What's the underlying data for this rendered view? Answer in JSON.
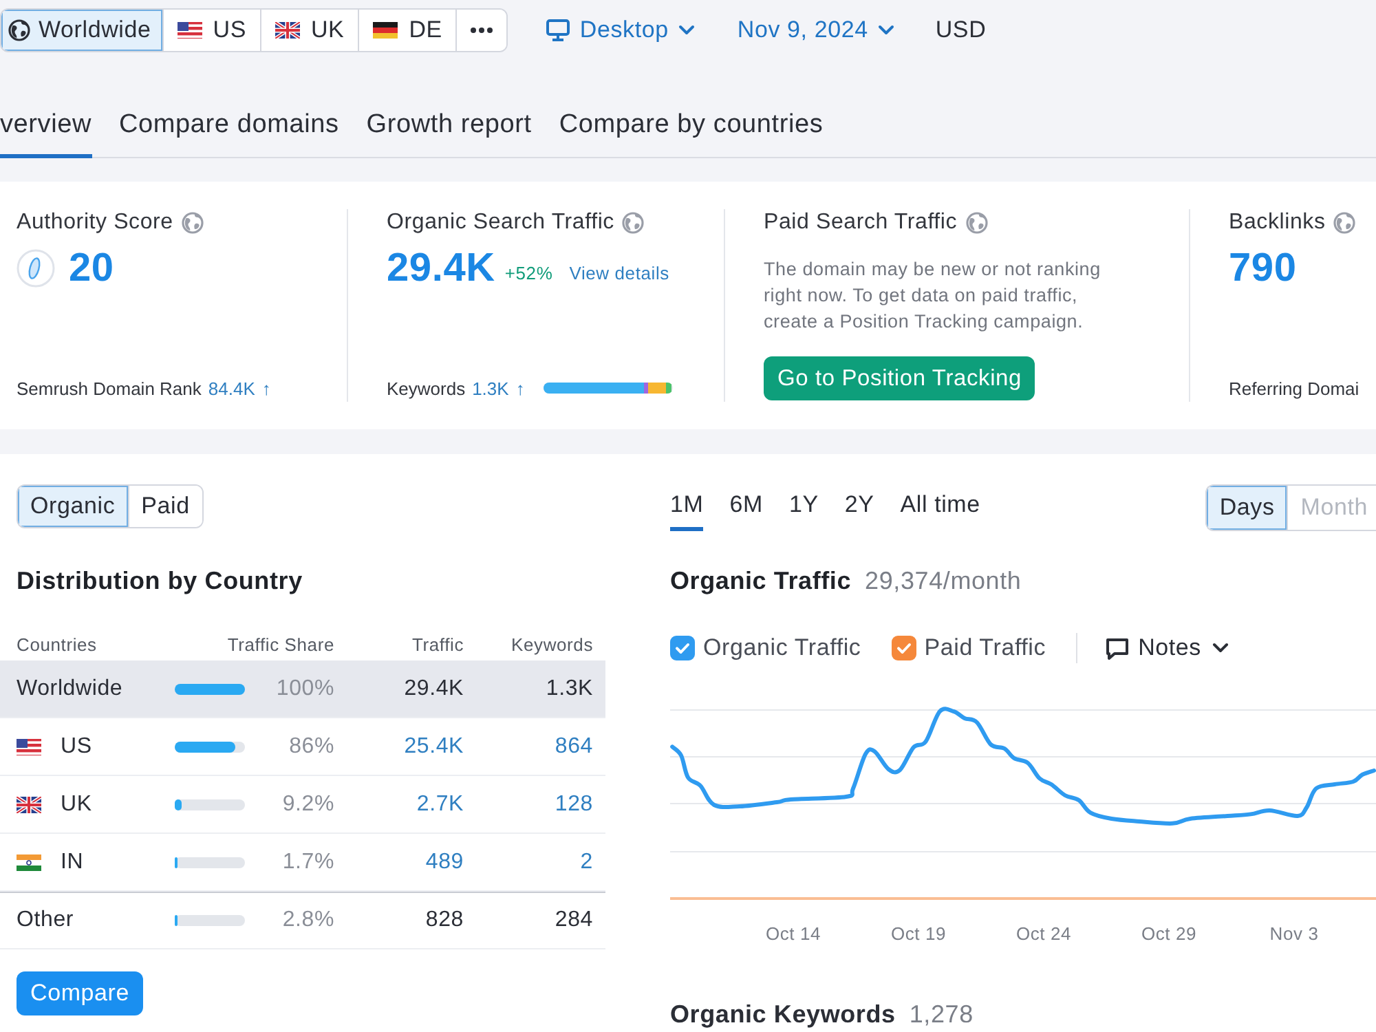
{
  "location_bar": {
    "regions": [
      {
        "kind": "globe",
        "label": "Worldwide",
        "selected": true
      },
      {
        "kind": "usa",
        "label": "US",
        "selected": false
      },
      {
        "kind": "britain",
        "label": "UK",
        "selected": false
      },
      {
        "kind": "germany",
        "label": "DE",
        "selected": false
      },
      {
        "kind": "more",
        "selected": false
      }
    ],
    "device": "Desktop",
    "date": "Nov 9, 2024",
    "currency": "USD"
  },
  "tabs": [
    {
      "label": "verview",
      "selected": true
    },
    {
      "label": "Compare domains",
      "selected": false
    },
    {
      "label": "Growth report",
      "selected": false
    },
    {
      "label": "Compare by countries",
      "selected": false
    }
  ],
  "metrics": [
    {
      "kind": "score",
      "title": "Authority Score",
      "value": "20",
      "footer_label": "Semrush Domain Rank",
      "footer_value": "84.4K",
      "footer_trend": "↑"
    },
    {
      "kind": "traffic",
      "title": "Organic Search Traffic",
      "value": "29.4K",
      "change": "+52%",
      "link": "View details",
      "footer_label": "Keywords",
      "footer_value": "1.3K",
      "footer_trend": "↑",
      "segments": [
        {
          "color": "#3ab0f2",
          "level": 0.77
        },
        {
          "color": "#a066e0",
          "level": 0.04
        },
        {
          "color": "#f7b731",
          "level": 0.13
        },
        {
          "color": "#4cc36b",
          "level": 0.05
        }
      ]
    },
    {
      "kind": "message",
      "title": "Paid Search Traffic",
      "message": "The domain may be new or not ranking right now. To get data on paid traffic, create a Position Tracking campaign.",
      "button": "Go to Position Tracking"
    },
    {
      "kind": "count",
      "title": "Backlinks",
      "value": "790",
      "footer_label": "Referring Domai"
    }
  ],
  "traffic_type": [
    {
      "label": "Organic",
      "selected": true
    },
    {
      "label": "Paid",
      "selected": false
    }
  ],
  "distribution": {
    "title": "Distribution by Country",
    "columns": [
      "Countries",
      "Traffic Share",
      "Traffic",
      "Keywords"
    ],
    "rows": [
      {
        "kind": "total",
        "country": "Worldwide",
        "selected": true,
        "level": 1,
        "share": "100%",
        "traffic": "29.4K",
        "keywords": "1.3K"
      },
      {
        "kind": "usa",
        "country": "US",
        "selected": false,
        "level": 0.86,
        "share": "86%",
        "traffic": "25.4K",
        "keywords": "864"
      },
      {
        "kind": "britain",
        "country": "UK",
        "selected": false,
        "level": 0.092,
        "share": "9.2%",
        "traffic": "2.7K",
        "keywords": "128"
      },
      {
        "kind": "india",
        "country": "IN",
        "selected": false,
        "level": 0.017,
        "share": "1.7%",
        "traffic": "489",
        "keywords": "2"
      },
      {
        "kind": "other",
        "country": "Other",
        "selected": false,
        "level": 0.028,
        "share": "2.8%",
        "traffic": "828",
        "keywords": "284"
      }
    ]
  },
  "compare_button": "Compare",
  "periods": [
    {
      "label": "1M",
      "selected": true
    },
    {
      "label": "6M",
      "selected": false
    },
    {
      "label": "1Y",
      "selected": false
    },
    {
      "label": "2Y",
      "selected": false
    },
    {
      "label": "All time",
      "selected": false
    }
  ],
  "granularity": [
    {
      "label": "Days",
      "selected": true
    },
    {
      "label": "Month",
      "selected": false
    }
  ],
  "chart": {
    "title": "Organic Traffic",
    "summary": "29,374/month",
    "legend": [
      {
        "label": "Organic Traffic",
        "checked": true,
        "color": "#2f9bf0"
      },
      {
        "label": "Paid Traffic",
        "checked": true,
        "color": "#f5883b"
      }
    ],
    "notes": "Notes",
    "x_labels": [
      "Oct 14",
      "Oct 19",
      "Oct 24",
      "Oct 29",
      "Nov 3"
    ]
  },
  "keywords": {
    "title": "Organic Keywords",
    "count": "1,278"
  }
}
